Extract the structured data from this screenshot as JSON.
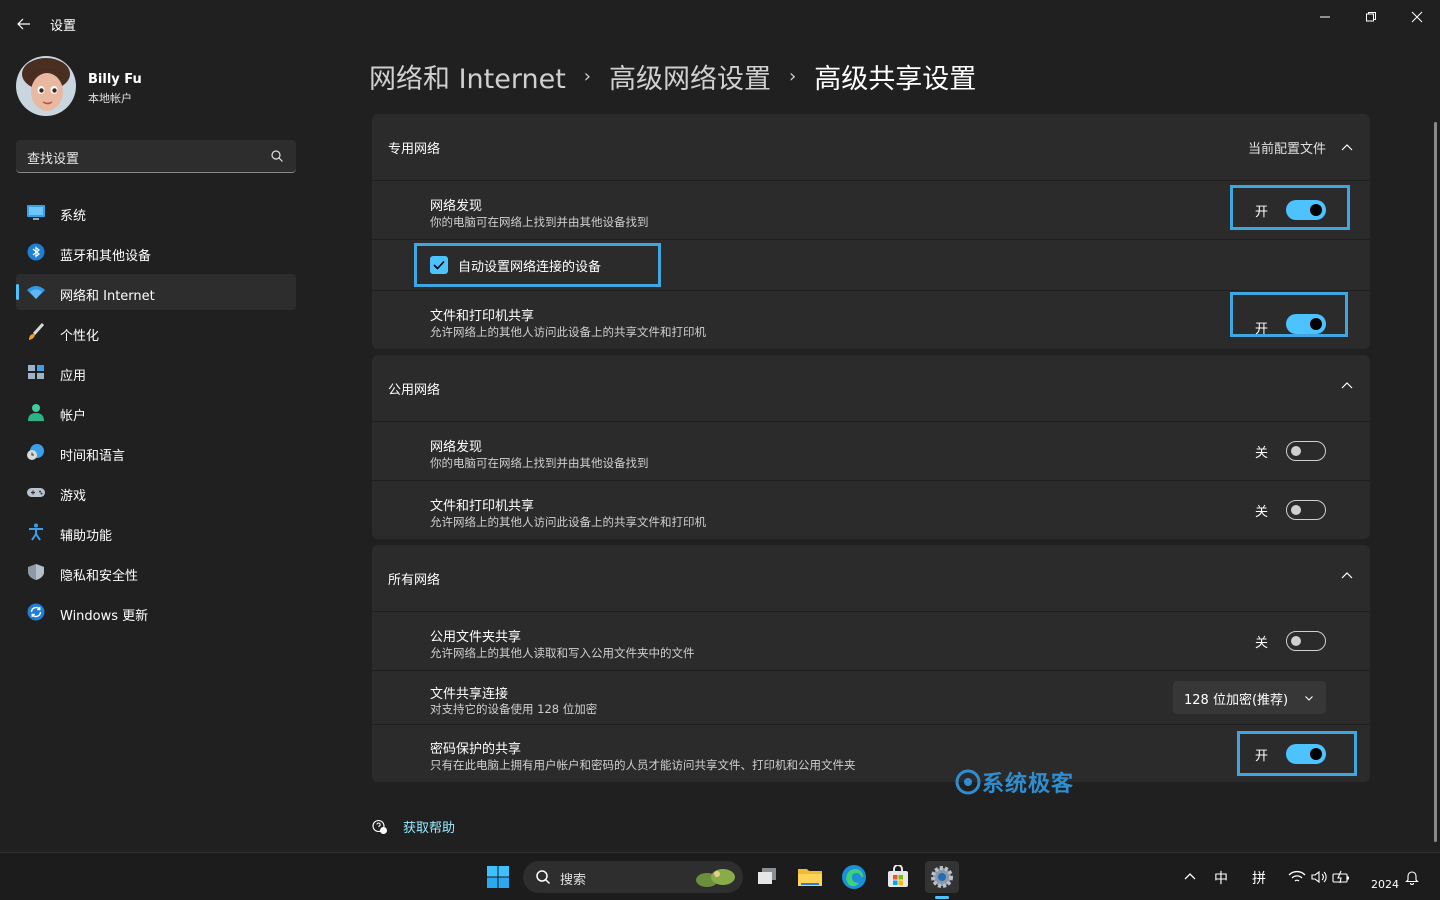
{
  "window": {
    "title": "设置",
    "back_icon": "arrow-left-icon",
    "controls": [
      "minimize-icon",
      "maximize-icon",
      "close-icon"
    ]
  },
  "user": {
    "name": "Billy Fu",
    "account_type": "本地帐户"
  },
  "search": {
    "placeholder": "查找设置"
  },
  "sidebar": {
    "items": [
      {
        "label": "系统",
        "icon": "monitor-icon"
      },
      {
        "label": "蓝牙和其他设备",
        "icon": "bluetooth-icon"
      },
      {
        "label": "网络和 Internet",
        "icon": "wifi-icon",
        "active": true
      },
      {
        "label": "个性化",
        "icon": "paintbrush-icon"
      },
      {
        "label": "应用",
        "icon": "apps-icon"
      },
      {
        "label": "帐户",
        "icon": "person-icon"
      },
      {
        "label": "时间和语言",
        "icon": "globe-clock-icon"
      },
      {
        "label": "游戏",
        "icon": "gamepad-icon"
      },
      {
        "label": "辅助功能",
        "icon": "accessibility-icon"
      },
      {
        "label": "隐私和安全性",
        "icon": "shield-icon"
      },
      {
        "label": "Windows 更新",
        "icon": "update-icon"
      }
    ]
  },
  "breadcrumb": {
    "items": [
      "网络和 Internet",
      "高级网络设置",
      "高级共享设置"
    ],
    "separator": "›"
  },
  "private_network": {
    "title": "专用网络",
    "badge": "当前配置文件",
    "discovery": {
      "title": "网络发现",
      "desc": "你的电脑可在网络上找到并由其他设备找到",
      "state": "开"
    },
    "auto_setup": {
      "label": "自动设置网络连接的设备",
      "checked": true
    },
    "file_printer": {
      "title": "文件和打印机共享",
      "desc": "允许网络上的其他人访问此设备上的共享文件和打印机",
      "state": "开"
    }
  },
  "public_network": {
    "title": "公用网络",
    "discovery": {
      "title": "网络发现",
      "desc": "你的电脑可在网络上找到并由其他设备找到",
      "state": "关"
    },
    "file_printer": {
      "title": "文件和打印机共享",
      "desc": "允许网络上的其他人访问此设备上的共享文件和打印机",
      "state": "关"
    }
  },
  "all_networks": {
    "title": "所有网络",
    "public_folder": {
      "title": "公用文件夹共享",
      "desc": "允许网络上的其他人读取和写入公用文件夹中的文件",
      "state": "关"
    },
    "file_sharing_conn": {
      "title": "文件共享连接",
      "desc": "对支持它的设备使用 128 位加密",
      "value": "128 位加密(推荐)"
    },
    "password_sharing": {
      "title": "密码保护的共享",
      "desc": "只有在此电脑上拥有用户帐户和密码的人员才能访问共享文件、打印机和公用文件夹",
      "state": "开"
    }
  },
  "help": {
    "label": "获取帮助"
  },
  "watermark": {
    "text": "系统极客"
  },
  "taskbar": {
    "search_label": "搜索",
    "ime_mode": "中",
    "ime_layout": "拼",
    "clock": "2024",
    "accent": "#4cc2ff"
  }
}
